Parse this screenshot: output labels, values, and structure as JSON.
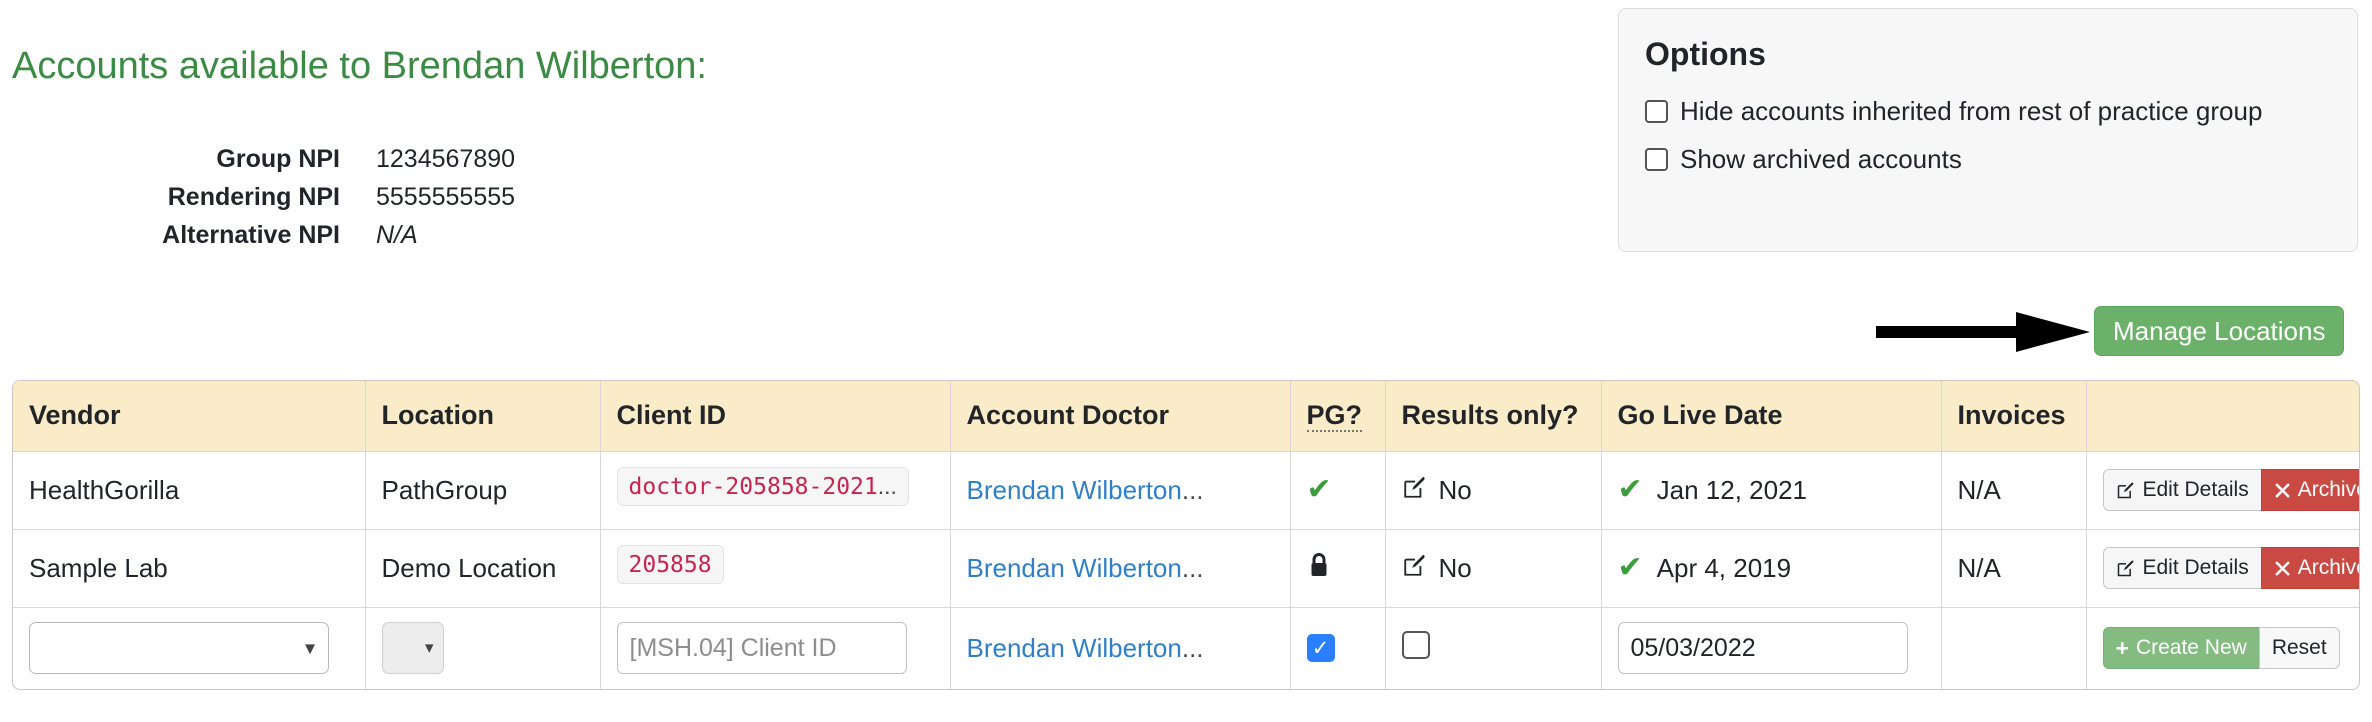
{
  "header": {
    "title": "Accounts available to Brendan Wilberton:",
    "title_color": "#3c8b45",
    "npi": [
      {
        "term": "Group NPI",
        "value": "1234567890",
        "italic": false
      },
      {
        "term": "Rendering NPI",
        "value": "5555555555",
        "italic": false
      },
      {
        "term": "Alternative NPI",
        "value": "N/A",
        "italic": true
      }
    ]
  },
  "options": {
    "title": "Options",
    "items": [
      {
        "label": "Hide accounts inherited from rest of practice group",
        "checked": false
      },
      {
        "label": "Show archived accounts",
        "checked": false
      }
    ]
  },
  "toolbar": {
    "manage_locations_label": "Manage Locations",
    "manage_locations_color": "#6cb16a",
    "arrow_icon": "arrow-right-icon"
  },
  "table": {
    "columns": [
      {
        "key": "vendor",
        "label": "Vendor"
      },
      {
        "key": "location",
        "label": "Location"
      },
      {
        "key": "client",
        "label": "Client ID"
      },
      {
        "key": "doctor",
        "label": "Account Doctor"
      },
      {
        "key": "pg",
        "label": "PG?",
        "abbr": true
      },
      {
        "key": "results",
        "label": "Results only?"
      },
      {
        "key": "golive",
        "label": "Go Live Date"
      },
      {
        "key": "invoices",
        "label": "Invoices"
      },
      {
        "key": "actions",
        "label": ""
      }
    ],
    "header_bg": "#faecc9",
    "rows": [
      {
        "vendor": "HealthGorilla",
        "location": "PathGroup",
        "client_id": "doctor-205858-2021",
        "client_id_ellipsis": "...",
        "doctor": "Brendan Wilberton",
        "doctor_ellipsis": "...",
        "pg_icon": "check-icon",
        "results_icon": "edit-pencil-icon",
        "results_value": "No",
        "golive_icon": "check-icon",
        "golive_value": "Jan 12, 2021",
        "invoices": "N/A",
        "actions": [
          {
            "label": "Edit Details",
            "icon": "edit-pencil-icon",
            "style": "light"
          },
          {
            "label": "Archive",
            "icon": "close-x-icon",
            "style": "danger"
          }
        ]
      },
      {
        "vendor": "Sample Lab",
        "location": "Demo Location",
        "client_id": "205858",
        "client_id_ellipsis": "",
        "doctor": "Brendan Wilberton",
        "doctor_ellipsis": "...",
        "pg_icon": "lock-icon",
        "results_icon": "edit-pencil-icon",
        "results_value": "No",
        "golive_icon": "check-icon",
        "golive_value": "Apr 4, 2019",
        "invoices": "N/A",
        "actions": [
          {
            "label": "Edit Details",
            "icon": "edit-pencil-icon",
            "style": "light"
          },
          {
            "label": "Archive",
            "icon": "close-x-icon",
            "style": "danger"
          }
        ]
      }
    ],
    "new_row": {
      "vendor_select_value": "",
      "vendor_select_options": [
        ""
      ],
      "location_select_value": "",
      "location_select_options": [
        ""
      ],
      "client_id_placeholder": "[MSH.04] Client ID",
      "client_id_value": "",
      "doctor": "Brendan Wilberton",
      "doctor_ellipsis": "...",
      "pg_checked": true,
      "pg_checkbox_color": "#2a7fff",
      "results_checked": false,
      "golive_value": "05/03/2022",
      "invoices": "",
      "actions": [
        {
          "label": "Create New",
          "icon": "plus-icon",
          "style": "success"
        },
        {
          "label": "Reset",
          "icon": "",
          "style": "light"
        }
      ]
    }
  }
}
